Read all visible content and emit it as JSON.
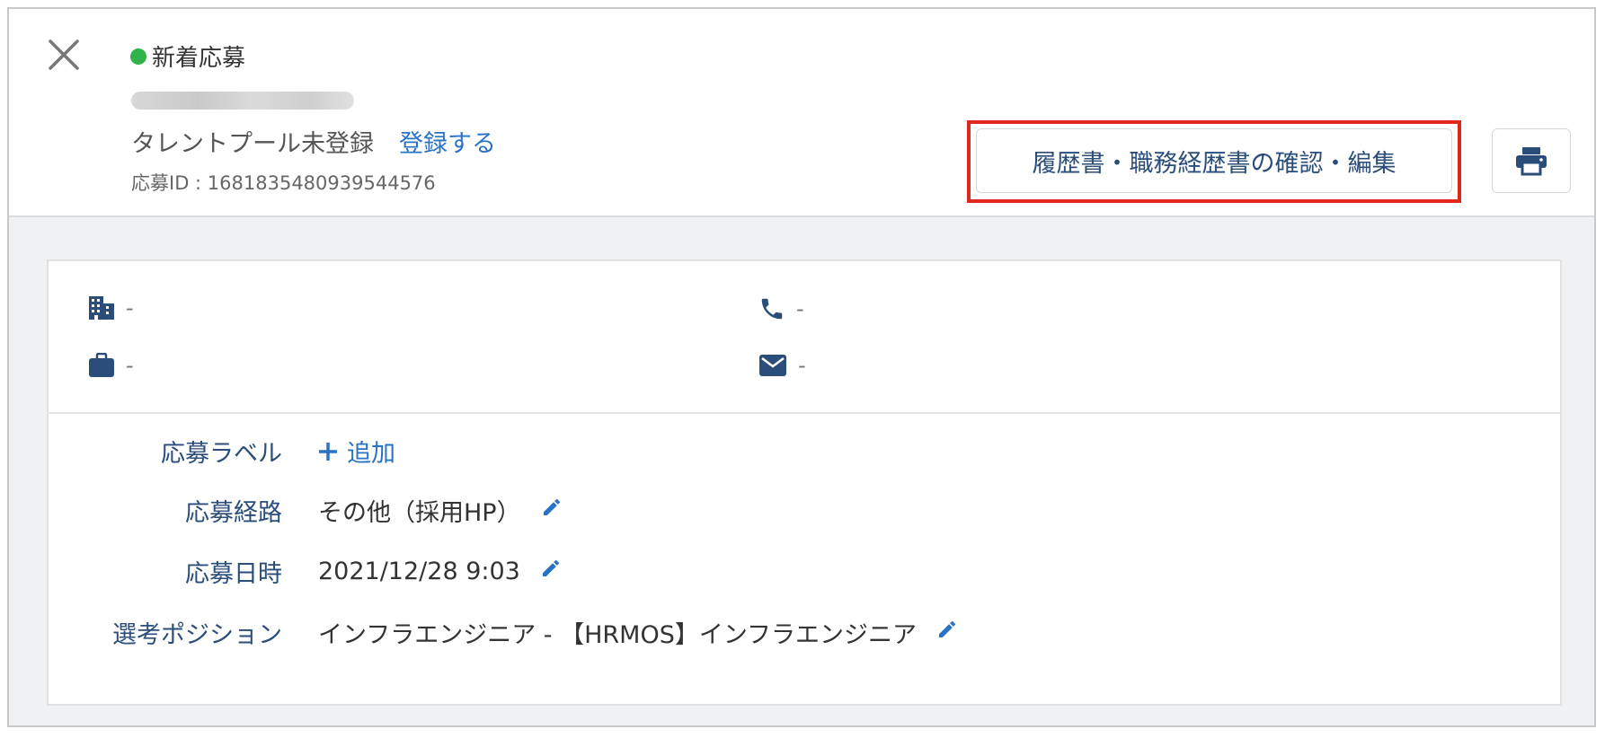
{
  "header": {
    "status": "新着応募",
    "status_color": "#2fb34a",
    "talent_status": "タレントプール未登録",
    "register_link": "登録する",
    "application_id": "応募ID : 1681835480939544576",
    "resume_button": "履歴書・職務経歴書の確認・編集",
    "print_icon": "printer-icon",
    "close_icon": "close-icon"
  },
  "contact": {
    "company": {
      "icon": "building-icon",
      "value": "-"
    },
    "phone": {
      "icon": "phone-icon",
      "value": "-"
    },
    "job": {
      "icon": "briefcase-icon",
      "value": "-"
    },
    "email": {
      "icon": "mail-icon",
      "value": "-"
    }
  },
  "details": {
    "label_row": {
      "label": "応募ラベル",
      "add_text": "追加"
    },
    "source_row": {
      "label": "応募経路",
      "value": "その他（採用HP）"
    },
    "date_row": {
      "label": "応募日時",
      "value": "2021/12/28 9:03"
    },
    "position_row": {
      "label": "選考ポジション",
      "value": "インフラエンジニア - 【HRMOS】インフラエンジニア"
    }
  },
  "colors": {
    "accent": "#2a72c5",
    "label": "#2b4d7a",
    "highlight": "#e0271e"
  }
}
